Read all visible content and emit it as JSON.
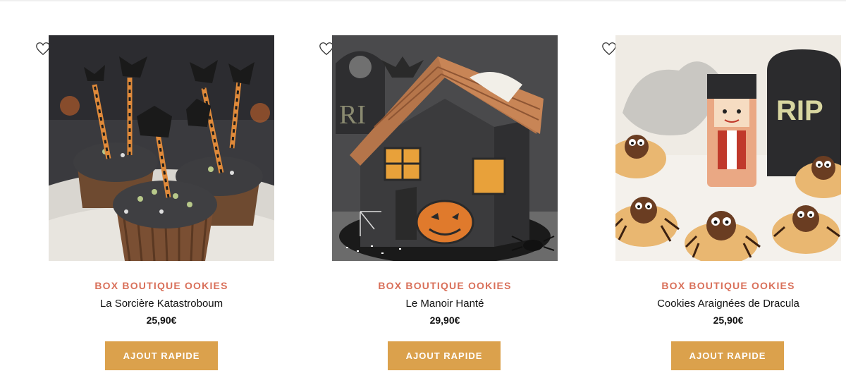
{
  "colors": {
    "brand": "#d9705a",
    "button": "#dba14c",
    "text": "#111111"
  },
  "products": [
    {
      "image_alt": "La Sorcière Katastroboum",
      "brand": "BOX BOUTIQUE OOKIES",
      "name": "La Sorcière Katastroboum",
      "price": "25,90€",
      "button_label": "AJOUT RAPIDE",
      "wishlist_icon": "heart-icon"
    },
    {
      "image_alt": "Le Manoir Hanté",
      "brand": "BOX BOUTIQUE OOKIES",
      "name": "Le Manoir Hanté",
      "price": "29,90€",
      "button_label": "AJOUT RAPIDE",
      "wishlist_icon": "heart-icon"
    },
    {
      "image_alt": "Cookies Araignées de Dracula",
      "brand": "BOX BOUTIQUE OOKIES",
      "name": "Cookies Araignées de Dracula",
      "price": "25,90€",
      "button_label": "AJOUT RAPIDE",
      "wishlist_icon": "heart-icon"
    }
  ]
}
